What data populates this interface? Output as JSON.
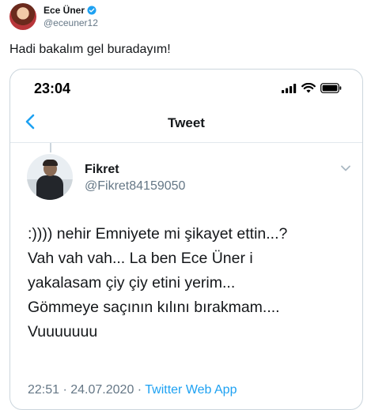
{
  "outer_tweet": {
    "author_name": "Ece Üner",
    "author_handle": "@eceuner12",
    "text": "Hadi bakalım gel buradayım!"
  },
  "screenshot": {
    "status_bar": {
      "time": "23:04"
    },
    "nav": {
      "title": "Tweet"
    },
    "tweet": {
      "author_name": "Fikret",
      "author_handle": "@Fikret84159050",
      "lines": [
        ":))))  nehir Emniyete mi şikayet ettin...?",
        "Vah vah vah... La ben Ece Üner i",
        "yakalasam çiy çiy etini yerim...",
        "Gömmeye saçının kılını bırakmam....",
        "Vuuuuuuu"
      ],
      "timestamp": "22:51 · 24.07.2020 · ",
      "client": "Twitter Web App"
    }
  },
  "colors": {
    "accent": "#1da1f2",
    "secondary_text": "#657786",
    "border": "#ccd6dd"
  },
  "icons": [
    "verified-badge-icon",
    "signal-icon",
    "wifi-icon",
    "battery-icon",
    "back-chevron-icon",
    "chevron-down-icon"
  ]
}
